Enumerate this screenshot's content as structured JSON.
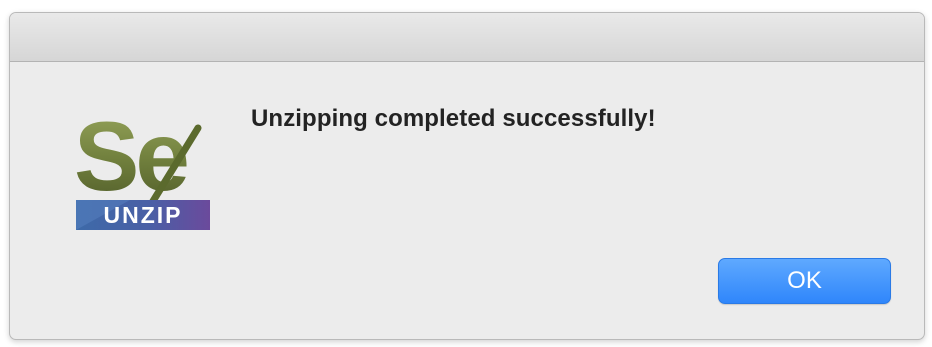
{
  "dialog": {
    "icon": {
      "name": "se-unzip-app-icon",
      "logo_text": "Se",
      "badge_text": "UNZIP",
      "colors": {
        "logo_green": "#6f7e3c",
        "badge_blue": "#3d6aa8",
        "badge_purple": "#6b4a9c"
      }
    },
    "message": "Unzipping completed successfully!",
    "ok_label": "OK"
  },
  "colors": {
    "dialog_background": "#ececec",
    "button_accent": "#2f86fb"
  }
}
